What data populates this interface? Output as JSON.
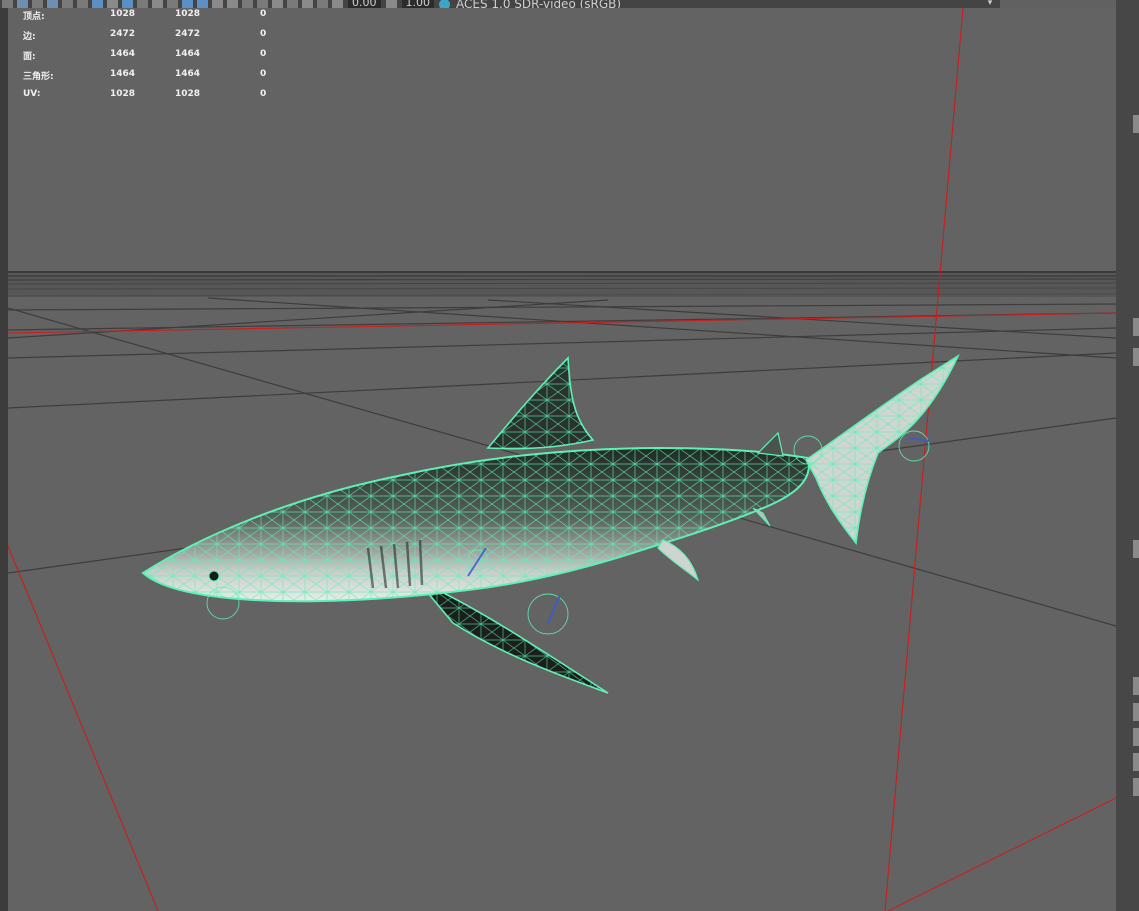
{
  "toolbar": {
    "exposure_value": "0.00",
    "gamma_value": "1.00",
    "color_space_label": "ACES 1.0 SDR-video (sRGB)",
    "icons": [
      "select-icon",
      "lasso-icon",
      "paint-icon",
      "move-icon",
      "rotate-icon",
      "scale-icon",
      "grid-icon",
      "wireframe-icon",
      "smooth-shade-icon",
      "textured-icon",
      "lights-icon",
      "shadows-icon",
      "xray-icon",
      "isolate-icon",
      "camera-icon",
      "film-gate-icon",
      "resolution-gate-icon",
      "exposure-icon",
      "gamma-icon",
      "color-management-icon"
    ]
  },
  "heads_up_display": {
    "rows": [
      {
        "label": "顶点:",
        "value1": "1028",
        "value2": "1028",
        "value3": "0"
      },
      {
        "label": "边:",
        "value1": "2472",
        "value2": "2472",
        "value3": "0"
      },
      {
        "label": "面:",
        "value1": "1464",
        "value2": "1464",
        "value3": "0"
      },
      {
        "label": "三角形:",
        "value1": "1464",
        "value2": "1464",
        "value3": "0"
      },
      {
        "label": "UV:",
        "value1": "1028",
        "value2": "1028",
        "value3": "0"
      }
    ]
  },
  "viewport": {
    "background_color": "#636363",
    "grid_color": "#3a3a3a",
    "axis_color": "#c81e1e",
    "wireframe_color": "#5ff0b4",
    "object": "shark-model"
  }
}
